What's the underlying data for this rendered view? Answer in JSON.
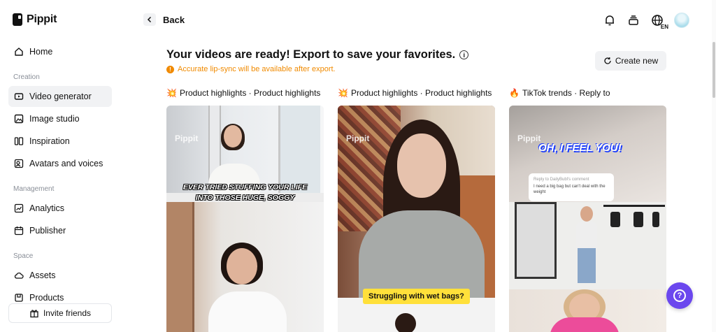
{
  "app": {
    "name": "Pippit"
  },
  "sidebar": {
    "home": {
      "label": "Home",
      "icon": "home-icon"
    },
    "sections": [
      {
        "label": "Creation"
      },
      {
        "label": "Management"
      },
      {
        "label": "Space"
      }
    ],
    "items": [
      {
        "label": "Video generator",
        "icon": "video-generator-icon",
        "active": true
      },
      {
        "label": "Image studio",
        "icon": "image-studio-icon"
      },
      {
        "label": "Inspiration",
        "icon": "inspiration-icon"
      },
      {
        "label": "Avatars and voices",
        "icon": "avatar-voice-icon"
      },
      {
        "label": "Analytics",
        "icon": "analytics-icon"
      },
      {
        "label": "Publisher",
        "icon": "calendar-icon"
      },
      {
        "label": "Assets",
        "icon": "cloud-icon"
      },
      {
        "label": "Products",
        "icon": "products-icon"
      }
    ],
    "invite": {
      "label": "Invite friends",
      "icon": "gift-icon"
    }
  },
  "header": {
    "back_label": "Back",
    "language_code": "EN"
  },
  "main": {
    "headline": "Your videos are ready! Export to save your favorites.",
    "notice": "Accurate lip-sync will be available after export.",
    "notice_color": "#f08a00",
    "create_new": "Create new",
    "cards": [
      {
        "emoji": "💥",
        "title": "Product highlights · Product highlights",
        "watermark": "Pippit",
        "caption": "EVER TRIED STUFFING YOUR LIFE INTO THOSE HUGE, SOGGY BAGS?"
      },
      {
        "emoji": "💥",
        "title": "Product highlights · Product highlights",
        "watermark": "Pippit",
        "caption": "Struggling with wet bags?"
      },
      {
        "emoji": "🔥",
        "title": "TikTok trends · Reply to",
        "watermark": "Pippit",
        "caption": "OH, I FEEL YOU!",
        "comment_reply": "Reply to DailyBubl's comment",
        "comment_text": "I need a big bag but can't deal with the weight"
      }
    ]
  },
  "colors": {
    "accent": "#6b47ee",
    "active_bg": "#f1f2f4"
  }
}
